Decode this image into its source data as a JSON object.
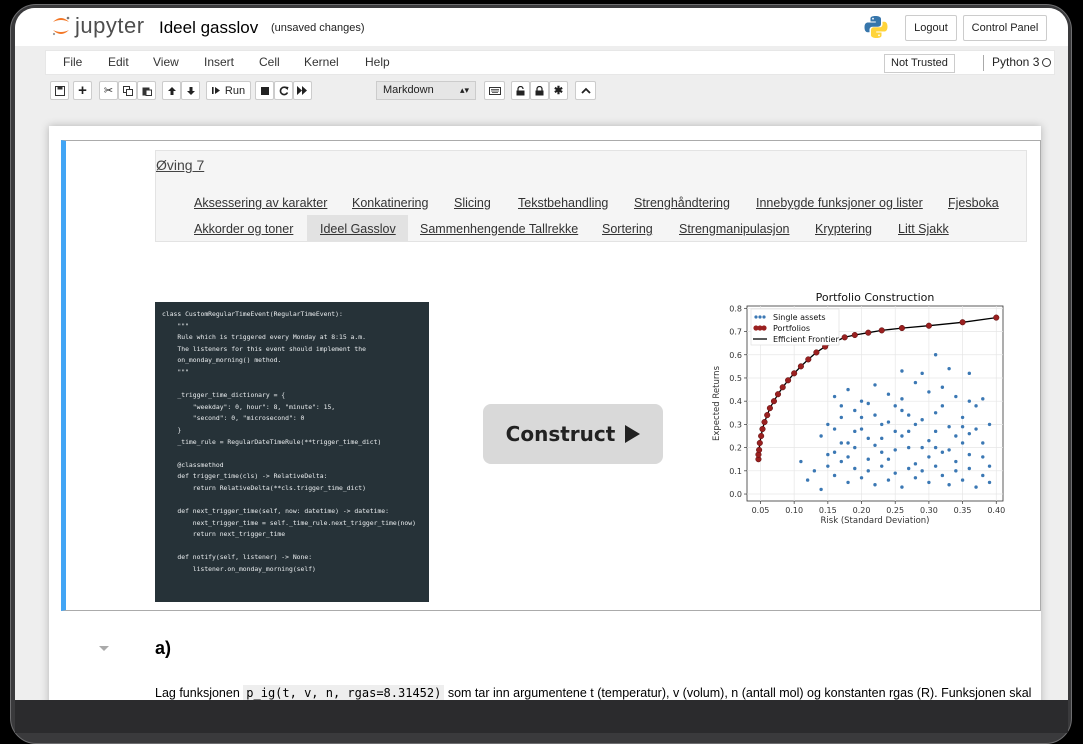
{
  "header": {
    "logo_text": "jupyter",
    "notebook_title": "Ideel gasslov",
    "save_status": "(unsaved changes)",
    "logout_label": "Logout",
    "control_panel_label": "Control Panel"
  },
  "menu": {
    "items": [
      "File",
      "Edit",
      "View",
      "Insert",
      "Cell",
      "Kernel",
      "Help"
    ],
    "trusted_label": "Not Trusted",
    "kernel_name": "Python 3"
  },
  "toolbar": {
    "run_label": "Run",
    "cell_type": "Markdown"
  },
  "nav": {
    "title": "Øving 7",
    "links_row1": [
      "Aksessering av karakter",
      "Konkatinering",
      "Slicing",
      "Tekstbehandling",
      "Strenghåndtering",
      "Innebygde funksjoner og lister",
      "Fjesboka"
    ],
    "links_row2": [
      "Akkorder og toner",
      "Ideel Gasslov",
      "Sammenhengende Tallrekke",
      "Sortering",
      "Strengmanipulasjon",
      "Kryptering",
      "Litt Sjakk"
    ],
    "active": "Ideel Gasslov"
  },
  "code_lines": [
    "class CustomRegularTimeEvent(RegularTimeEvent):",
    "    \"\"\"",
    "    Rule which is triggered every Monday at 8:15 a.m.",
    "    The listeners for this event should implement the",
    "    on_monday_morning() method.",
    "    \"\"\"",
    "",
    "    _trigger_time_dictionary = {",
    "        \"weekday\": 0, hour\": 8, \"minute\": 15,",
    "        \"second\": 0, \"microsecond\": 0",
    "    }",
    "    _time_rule = RegularDateTimeRule(**trigger_time_dict)",
    "",
    "    @classmethod",
    "    def trigger_time(cls) -> RelativeDelta:",
    "        return RelativeDelta(**cls.trigger_time_dict)",
    "",
    "    def next_trigger_time(self, now: datetime) -> datetime:",
    "        next_trigger_time = self._time_rule.next_trigger_time(now)",
    "        return next_trigger_time",
    "",
    "    def notify(self, listener) -> None:",
    "        listener.on_monday_morning(self)"
  ],
  "construct_label": "Construct",
  "chart_data": {
    "type": "scatter",
    "title": "Portfolio Construction",
    "xlabel": "Risk (Standard Deviation)",
    "ylabel": "Expected Returns",
    "xlim": [
      0.03,
      0.41
    ],
    "ylim": [
      -0.03,
      0.81
    ],
    "xticks": [
      "0.05",
      "0.10",
      "0.15",
      "0.20",
      "0.25",
      "0.30",
      "0.35",
      "0.40"
    ],
    "yticks": [
      "0.0",
      "0.1",
      "0.2",
      "0.3",
      "0.4",
      "0.5",
      "0.6",
      "0.7",
      "0.8"
    ],
    "grid": true,
    "legend_position": "top-left",
    "series": [
      {
        "name": "Single assets",
        "color": "#3b78b4",
        "points": [
          [
            0.16,
            0.42
          ],
          [
            0.18,
            0.45
          ],
          [
            0.2,
            0.4
          ],
          [
            0.22,
            0.47
          ],
          [
            0.24,
            0.43
          ],
          [
            0.26,
            0.41
          ],
          [
            0.28,
            0.48
          ],
          [
            0.3,
            0.44
          ],
          [
            0.32,
            0.46
          ],
          [
            0.34,
            0.42
          ],
          [
            0.36,
            0.4
          ],
          [
            0.38,
            0.41
          ],
          [
            0.33,
            0.54
          ],
          [
            0.36,
            0.52
          ],
          [
            0.31,
            0.6
          ],
          [
            0.29,
            0.52
          ],
          [
            0.26,
            0.53
          ],
          [
            0.14,
            0.25
          ],
          [
            0.15,
            0.3
          ],
          [
            0.16,
            0.18
          ],
          [
            0.17,
            0.33
          ],
          [
            0.18,
            0.22
          ],
          [
            0.19,
            0.36
          ],
          [
            0.2,
            0.28
          ],
          [
            0.21,
            0.15
          ],
          [
            0.22,
            0.34
          ],
          [
            0.23,
            0.24
          ],
          [
            0.24,
            0.31
          ],
          [
            0.25,
            0.19
          ],
          [
            0.26,
            0.36
          ],
          [
            0.27,
            0.27
          ],
          [
            0.28,
            0.13
          ],
          [
            0.29,
            0.32
          ],
          [
            0.3,
            0.23
          ],
          [
            0.31,
            0.35
          ],
          [
            0.32,
            0.18
          ],
          [
            0.33,
            0.29
          ],
          [
            0.34,
            0.25
          ],
          [
            0.35,
            0.33
          ],
          [
            0.36,
            0.17
          ],
          [
            0.37,
            0.28
          ],
          [
            0.38,
            0.22
          ],
          [
            0.39,
            0.3
          ],
          [
            0.15,
            0.12
          ],
          [
            0.16,
            0.08
          ],
          [
            0.17,
            0.14
          ],
          [
            0.18,
            0.05
          ],
          [
            0.19,
            0.11
          ],
          [
            0.2,
            0.07
          ],
          [
            0.21,
            0.1
          ],
          [
            0.22,
            0.04
          ],
          [
            0.23,
            0.12
          ],
          [
            0.24,
            0.06
          ],
          [
            0.25,
            0.09
          ],
          [
            0.26,
            0.03
          ],
          [
            0.27,
            0.11
          ],
          [
            0.28,
            0.07
          ],
          [
            0.29,
            0.1
          ],
          [
            0.3,
            0.05
          ],
          [
            0.31,
            0.12
          ],
          [
            0.32,
            0.08
          ],
          [
            0.33,
            0.04
          ],
          [
            0.34,
            0.1
          ],
          [
            0.35,
            0.06
          ],
          [
            0.36,
            0.11
          ],
          [
            0.37,
            0.03
          ],
          [
            0.38,
            0.08
          ],
          [
            0.39,
            0.05
          ],
          [
            0.13,
            0.1
          ],
          [
            0.12,
            0.06
          ],
          [
            0.14,
            0.02
          ],
          [
            0.11,
            0.14
          ],
          [
            0.17,
            0.38
          ],
          [
            0.21,
            0.39
          ],
          [
            0.25,
            0.38
          ],
          [
            0.27,
            0.2
          ],
          [
            0.19,
            0.2
          ],
          [
            0.23,
            0.18
          ],
          [
            0.31,
            0.27
          ],
          [
            0.35,
            0.22
          ],
          [
            0.37,
            0.38
          ],
          [
            0.16,
            0.28
          ],
          [
            0.2,
            0.33
          ],
          [
            0.24,
            0.15
          ],
          [
            0.28,
            0.3
          ],
          [
            0.32,
            0.38
          ],
          [
            0.34,
            0.14
          ],
          [
            0.38,
            0.16
          ],
          [
            0.18,
            0.16
          ],
          [
            0.22,
            0.21
          ],
          [
            0.26,
            0.25
          ],
          [
            0.3,
            0.16
          ],
          [
            0.33,
            0.19
          ],
          [
            0.36,
            0.26
          ],
          [
            0.29,
            0.2
          ],
          [
            0.25,
            0.27
          ],
          [
            0.21,
            0.24
          ],
          [
            0.17,
            0.22
          ],
          [
            0.15,
            0.17
          ],
          [
            0.19,
            0.27
          ],
          [
            0.23,
            0.3
          ],
          [
            0.27,
            0.34
          ],
          [
            0.31,
            0.2
          ],
          [
            0.35,
            0.29
          ],
          [
            0.39,
            0.12
          ]
        ]
      },
      {
        "name": "Portfolios",
        "color": "#9a2020",
        "points": [
          [
            0.047,
            0.15
          ],
          [
            0.047,
            0.17
          ],
          [
            0.048,
            0.19
          ],
          [
            0.049,
            0.22
          ],
          [
            0.051,
            0.25
          ],
          [
            0.053,
            0.28
          ],
          [
            0.056,
            0.31
          ],
          [
            0.06,
            0.34
          ],
          [
            0.064,
            0.37
          ],
          [
            0.07,
            0.4
          ],
          [
            0.076,
            0.43
          ],
          [
            0.083,
            0.46
          ],
          [
            0.091,
            0.49
          ],
          [
            0.1,
            0.52
          ],
          [
            0.11,
            0.55
          ],
          [
            0.121,
            0.58
          ],
          [
            0.133,
            0.61
          ],
          [
            0.146,
            0.635
          ],
          [
            0.16,
            0.655
          ],
          [
            0.175,
            0.675
          ],
          [
            0.19,
            0.685
          ],
          [
            0.21,
            0.695
          ],
          [
            0.23,
            0.705
          ],
          [
            0.26,
            0.715
          ],
          [
            0.3,
            0.725
          ],
          [
            0.35,
            0.74
          ],
          [
            0.4,
            0.76
          ]
        ]
      },
      {
        "name": "Efficient Frontier",
        "color": "#000000"
      }
    ]
  },
  "section": {
    "heading": "a)",
    "text_before": "Lag funksjonen",
    "code": "p_ig(t, v, n, rgas=8.31452)",
    "text_after": "som tar inn argumentene t (temperatur), v (volum), n (antall mol) og konstanten rgas (R). Funksjonen skal returnere trykket (p)."
  }
}
